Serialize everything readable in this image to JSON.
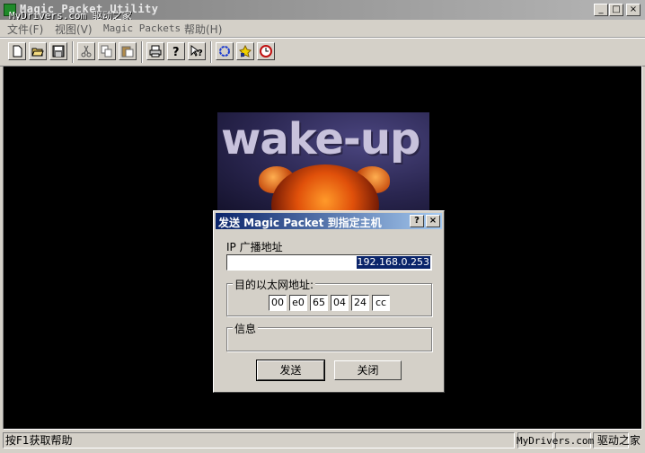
{
  "window": {
    "title": "Magic Packet Utility",
    "watermark": "MyDrivers.com 驱动之家",
    "controls": [
      "_",
      "□",
      "×"
    ]
  },
  "menu": [
    {
      "label": "文件(F)"
    },
    {
      "label": "视图(V)"
    },
    {
      "label": "Magic Packets"
    },
    {
      "label": "帮助(H)"
    }
  ],
  "toolbar": {
    "icons": [
      "new-icon",
      "open-icon",
      "save-icon",
      "cut-icon",
      "copy-icon",
      "paste-icon",
      "print-icon",
      "about-icon",
      "context-help-icon",
      "refresh-icon",
      "wake-icon",
      "timer-icon"
    ]
  },
  "banner": {
    "text": "wake-up"
  },
  "dialog": {
    "title": "发送 Magic Packet 到指定主机",
    "help_btn": "?",
    "close_btn": "×",
    "ip_label": "IP 广播地址",
    "ip_value": "192.168.0.253",
    "mac_label": "目的以太网地址:",
    "mac": [
      "00",
      "e0",
      "65",
      "04",
      "24",
      "cc"
    ],
    "info_label": "信息",
    "info_text": "",
    "send_label": "发送",
    "close_label": "关闭"
  },
  "status": {
    "text": "按F1获取帮助",
    "watermark_left": "MyDrivers.com",
    "watermark_right": "驱动之家"
  }
}
